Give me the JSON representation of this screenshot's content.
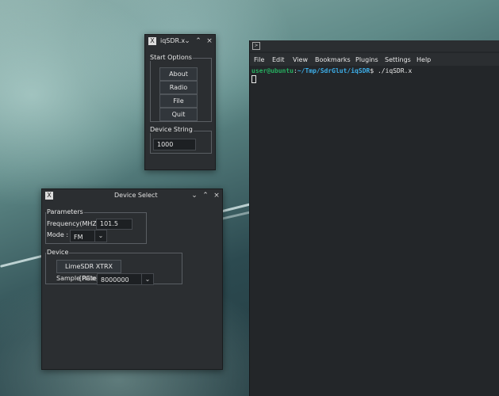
{
  "wallpaper": {
    "accent": "#8fb1ad"
  },
  "iq_window": {
    "title": "iqSDR.x",
    "start_options_label": "Start Options",
    "buttons": [
      "About",
      "Radio",
      "File",
      "Quit"
    ],
    "device_string_label": "Device String",
    "device_string_value": "1000"
  },
  "device_window": {
    "title": "Device Select",
    "parameters_label": "Parameters",
    "frequency_label": "Frequency(MHZ)",
    "frequency_value": "101.5",
    "mode_label": "Mode :",
    "mode_value": "FM",
    "device_label": "Device",
    "device_button": "LimeSDR XTRX [PCIe]",
    "sample_rate_label": "Sample Rate :",
    "sample_rate_value": "8000000"
  },
  "terminal": {
    "menu": [
      "File",
      "Edit",
      "View",
      "Bookmarks",
      "Plugins",
      "Settings",
      "Help"
    ],
    "prompt_user": "user@ubuntu",
    "prompt_sep": ":",
    "prompt_path": "~/Tmp/SdrGlut/iqSDR",
    "prompt_cmd": "$ ./iqSDR.x",
    "colors": {
      "user": "#27ae60",
      "path": "#3daee9"
    }
  },
  "icons": {
    "x_logo": "X",
    "minimize": "chevron-down-icon",
    "maximize": "chevron-up-icon",
    "close": "close-icon"
  }
}
